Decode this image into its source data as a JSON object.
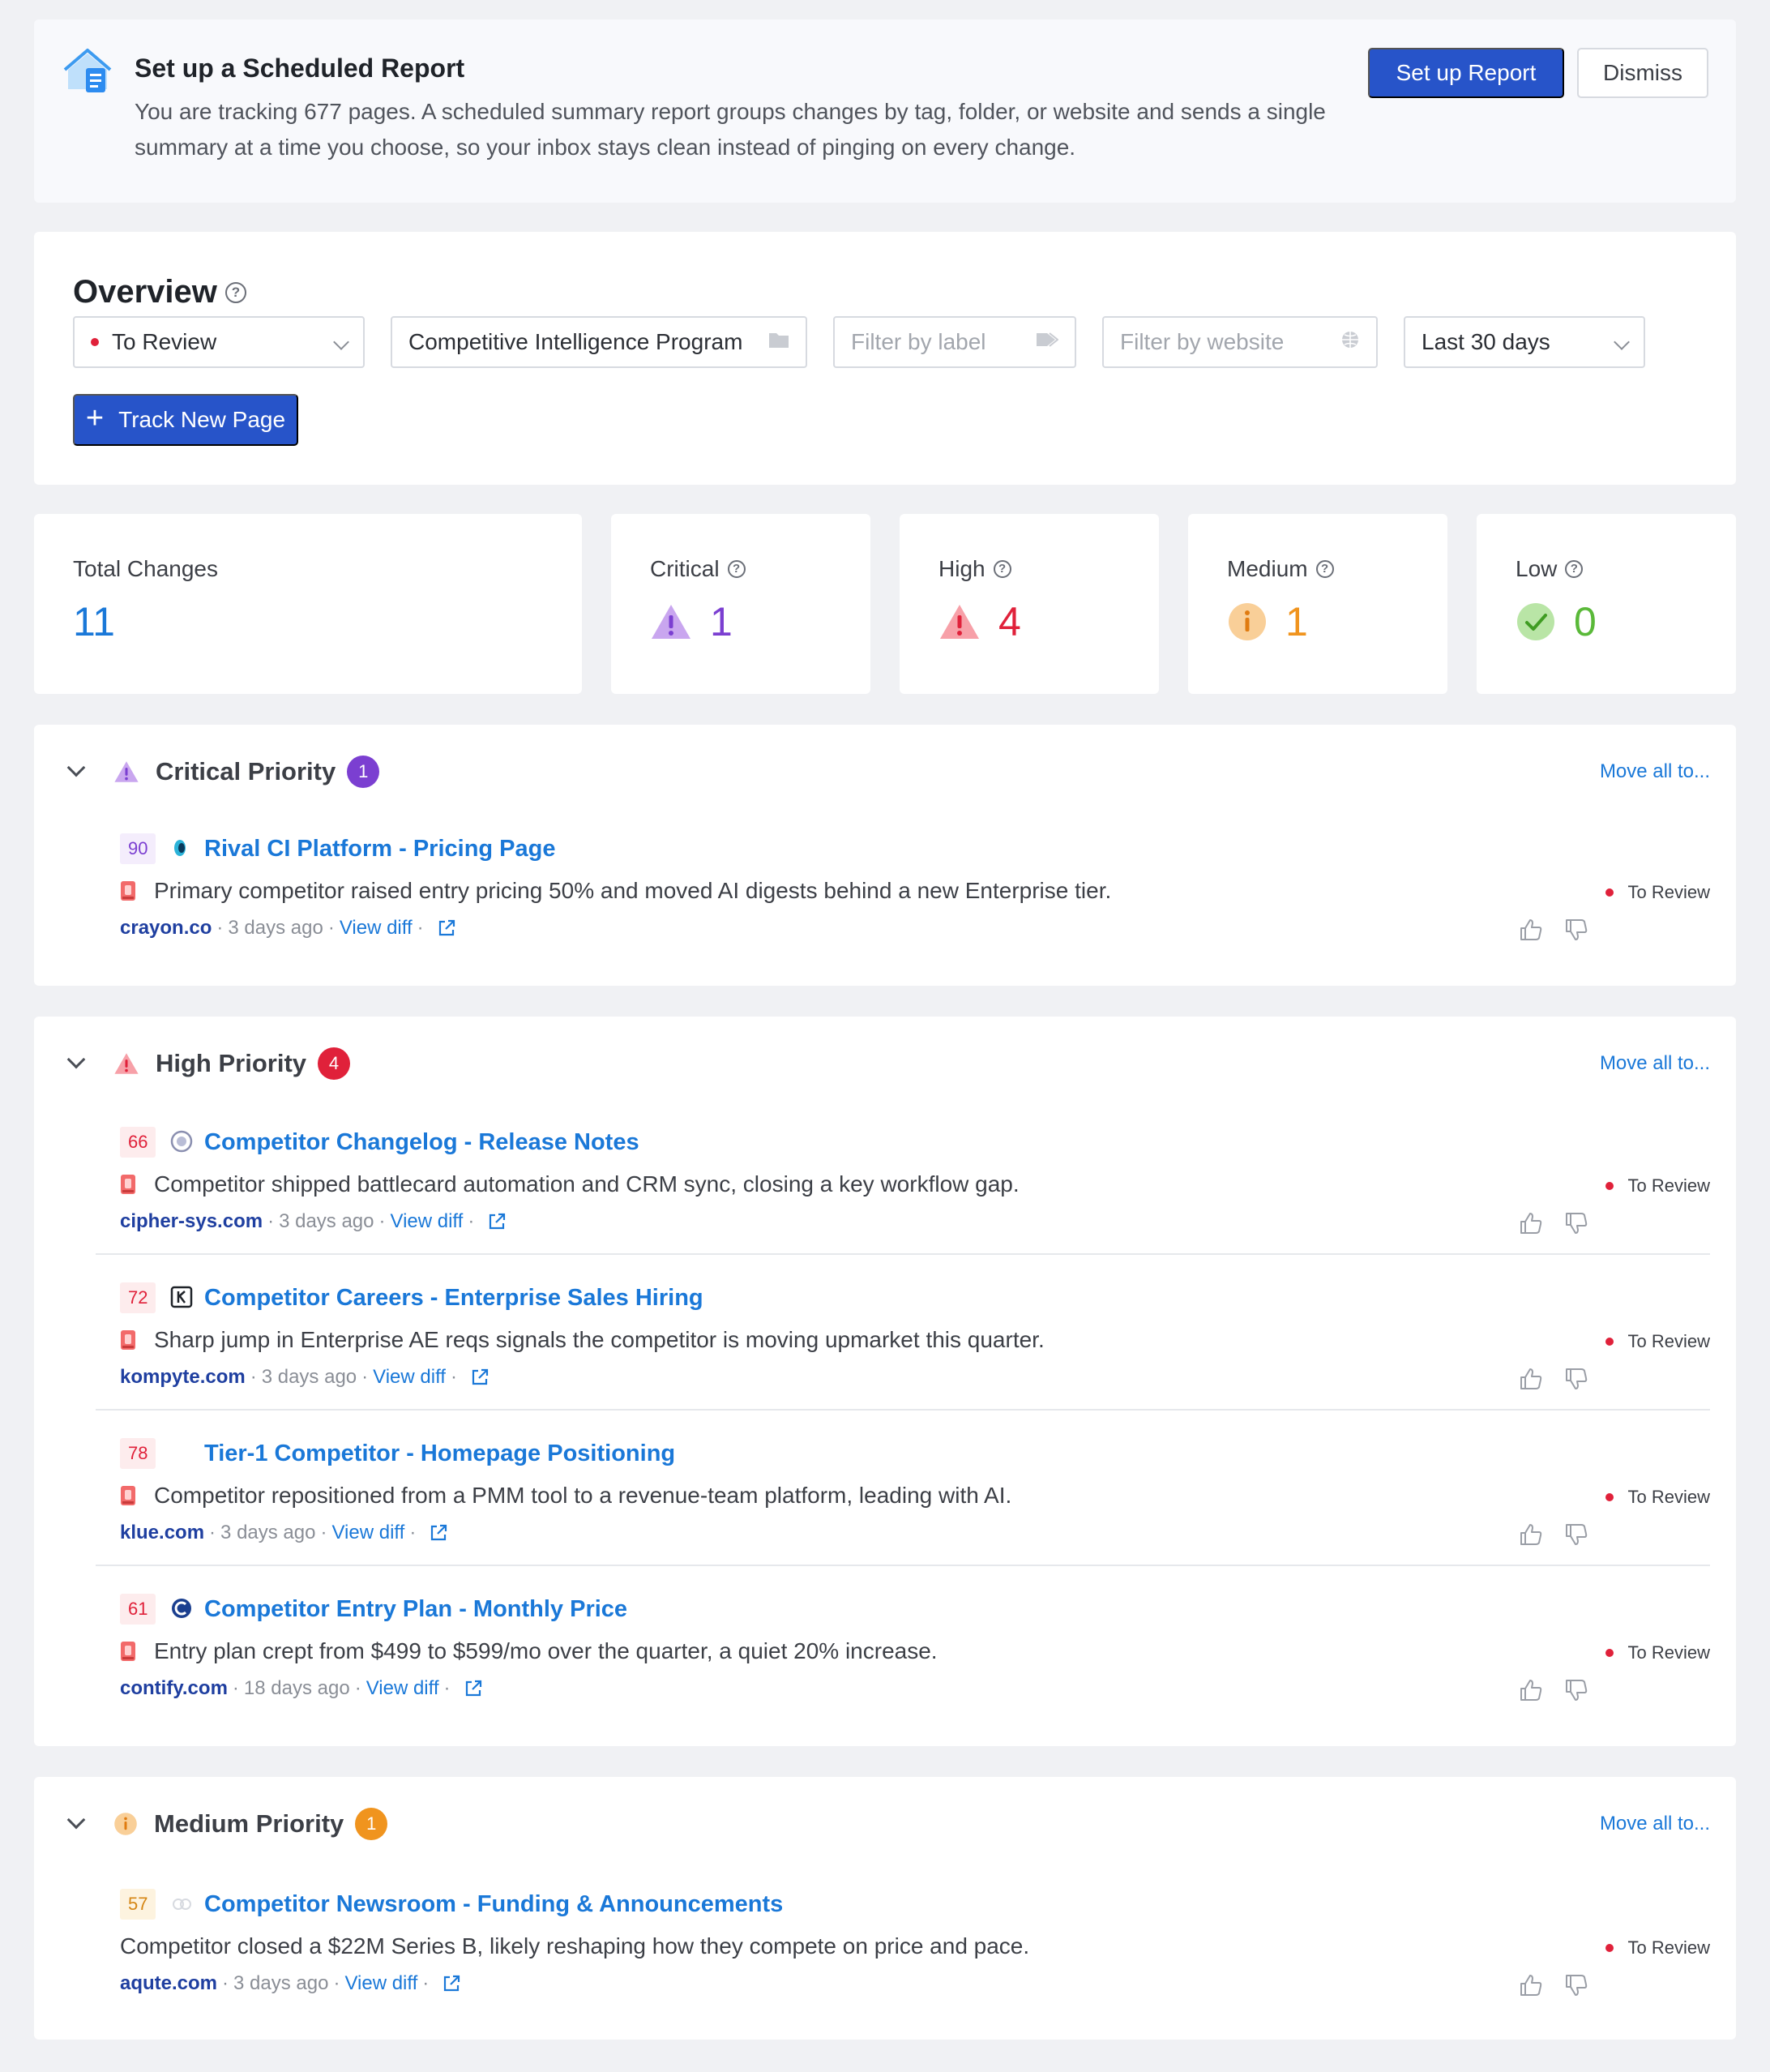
{
  "banner": {
    "title": "Set up a Scheduled Report",
    "text": "You are tracking 677 pages. A scheduled summary report groups changes by tag, folder, or website and sends a single summary at a time you choose, so your inbox stays clean instead of pinging on every change.",
    "setup_label": "Set up Report",
    "dismiss_label": "Dismiss"
  },
  "overview": {
    "title": "Overview",
    "status_filter": "To Review",
    "folder_filter": "Competitive Intelligence Program",
    "label_placeholder": "Filter by label",
    "website_placeholder": "Filter by website",
    "date_filter": "Last 30 days",
    "track_label": "Track New Page"
  },
  "stats": {
    "total": {
      "label": "Total Changes",
      "value": "11"
    },
    "critical": {
      "label": "Critical",
      "value": "1"
    },
    "high": {
      "label": "High",
      "value": "4"
    },
    "medium": {
      "label": "Medium",
      "value": "1"
    },
    "low": {
      "label": "Low",
      "value": "0"
    }
  },
  "groups": {
    "critical": {
      "title": "Critical Priority",
      "count": "1",
      "move_all": "Move all to...",
      "items": [
        {
          "score": "90",
          "title": "Rival CI Platform - Pricing Page",
          "desc": "Primary competitor raised entry pricing 50% and moved AI digests behind a new Enterprise tier.",
          "domain": "crayon.co",
          "time": "3 days ago",
          "diff": "View diff",
          "status": "To Review"
        }
      ]
    },
    "high": {
      "title": "High Priority",
      "count": "4",
      "move_all": "Move all to...",
      "items": [
        {
          "score": "66",
          "title": "Competitor Changelog - Release Notes",
          "desc": "Competitor shipped battlecard automation and CRM sync, closing a key workflow gap.",
          "domain": "cipher-sys.com",
          "time": "3 days ago",
          "diff": "View diff",
          "status": "To Review"
        },
        {
          "score": "72",
          "title": "Competitor Careers - Enterprise Sales Hiring",
          "desc": "Sharp jump in Enterprise AE reqs signals the competitor is moving upmarket this quarter.",
          "domain": "kompyte.com",
          "time": "3 days ago",
          "diff": "View diff",
          "status": "To Review"
        },
        {
          "score": "78",
          "title": "Tier-1 Competitor - Homepage Positioning",
          "desc": "Competitor repositioned from a PMM tool to a revenue-team platform, leading with AI.",
          "domain": "klue.com",
          "time": "3 days ago",
          "diff": "View diff",
          "status": "To Review"
        },
        {
          "score": "61",
          "title": "Competitor Entry Plan - Monthly Price",
          "desc": "Entry plan crept from $499 to $599/mo over the quarter, a quiet 20% increase.",
          "domain": "contify.com",
          "time": "18 days ago",
          "diff": "View diff",
          "status": "To Review"
        }
      ]
    },
    "medium": {
      "title": "Medium Priority",
      "count": "1",
      "move_all": "Move all to...",
      "items": [
        {
          "score": "57",
          "title": "Competitor Newsroom - Funding & Announcements",
          "desc": "Competitor closed a $22M Series B, likely reshaping how they compete on price and pace.",
          "domain": "aqute.com",
          "time": "3 days ago",
          "diff": "View diff",
          "status": "To Review"
        }
      ]
    }
  },
  "colors": {
    "primary_button": "#2754c9",
    "link": "#1a78d8",
    "critical": "#7b3fd1",
    "high": "#e0213a",
    "medium": "#f0941e",
    "low": "#5ab939",
    "total": "#1a78d8"
  },
  "icons": {
    "banner": "report-house-icon",
    "help": "question-circle-icon",
    "folder": "folder-icon",
    "label": "tag-icon",
    "website": "globe-icon",
    "critical": "warning-triangle-purple-icon",
    "high": "warning-triangle-red-icon",
    "medium": "info-circle-orange-icon",
    "low": "check-circle-green-icon",
    "item": "siren-icon",
    "external": "external-link-icon",
    "thumbs_up": "thumbs-up-icon",
    "thumbs_down": "thumbs-down-icon"
  }
}
